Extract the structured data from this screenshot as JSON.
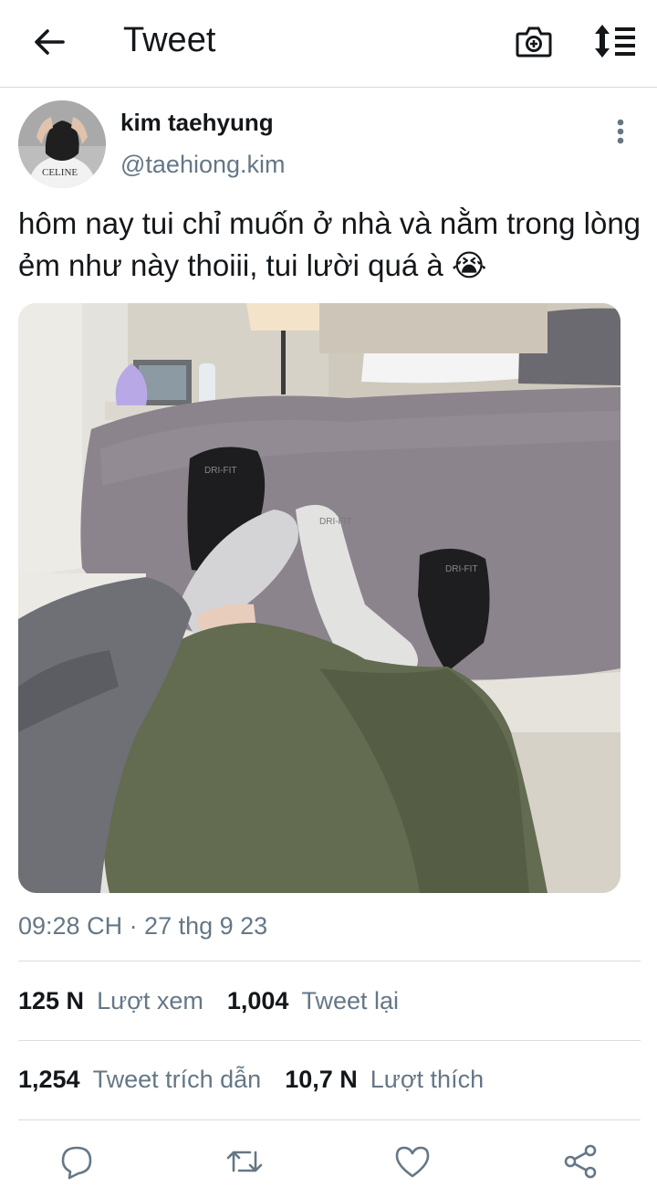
{
  "header": {
    "title": "Tweet",
    "back_icon": "arrow-left-icon",
    "camera_icon": "camera-icon",
    "sort_icon": "sort-icon"
  },
  "author": {
    "name": "kim taehyung",
    "handle": "@taehiong.kim",
    "avatar_shirt_text": "CELINE"
  },
  "tweet": {
    "text": "hôm nay tui chỉ muốn ở nhà và nằm trong lòng ẻm như này thoiii, tui lười quá à 😭",
    "timestamp": "09:28 CH · 27 thg 9 23"
  },
  "media": {
    "sock_label_1": "DRI-FIT",
    "sock_label_2": "DRI-FIT",
    "sock_label_3": "DRI-FIT"
  },
  "stats": {
    "views_count": "125 N",
    "views_label": "Lượt xem",
    "retweets_count": "1,004",
    "retweets_label": "Tweet lại",
    "quotes_count": "1,254",
    "quotes_label": "Tweet trích dẫn",
    "likes_count": "10,7 N",
    "likes_label": "Lượt thích"
  },
  "colors": {
    "text_primary": "#14171a",
    "text_secondary": "#657786",
    "icon_gray": "#657786",
    "divider": "#dcdcdc"
  }
}
